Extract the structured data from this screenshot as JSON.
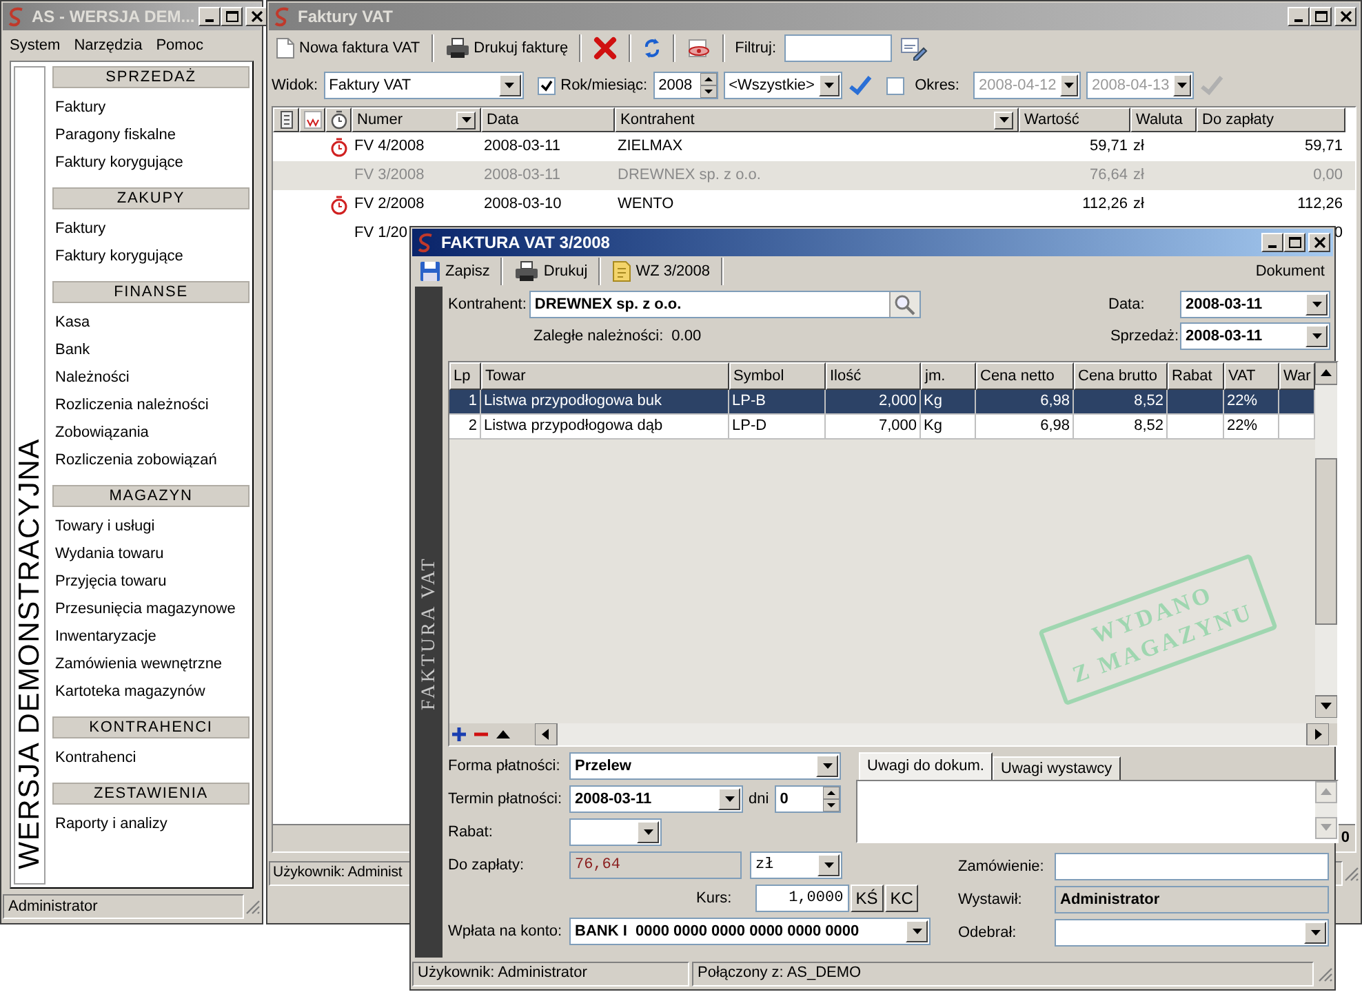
{
  "main_window": {
    "title": "AS - WERSJA DEM...",
    "active": false,
    "menu": [
      "System",
      "Narzędzia",
      "Pomoc"
    ],
    "side_label": "WERSJA DEMONSTRACYJNA",
    "sections": [
      {
        "title": "SPRZEDAŻ",
        "items": [
          "Faktury",
          "Paragony fiskalne",
          "Faktury korygujące"
        ]
      },
      {
        "title": "ZAKUPY",
        "items": [
          "Faktury",
          "Faktury korygujące"
        ]
      },
      {
        "title": "FINANSE",
        "items": [
          "Kasa",
          "Bank",
          "Należności",
          "Rozliczenia należności",
          "Zobowiązania",
          "Rozliczenia zobowiązań"
        ]
      },
      {
        "title": "MAGAZYN",
        "items": [
          "Towary i usługi",
          "Wydania towaru",
          "Przyjęcia towaru",
          "Przesunięcia magazynowe",
          "Inwentaryzacje",
          "Zamówienia wewnętrzne",
          "Kartoteka magazynów"
        ]
      },
      {
        "title": "KONTRAHENCI",
        "items": [
          "Kontrahenci"
        ]
      },
      {
        "title": "ZESTAWIENIA",
        "items": [
          "Raporty i analizy"
        ]
      }
    ],
    "status_bar": "Administrator"
  },
  "list_window": {
    "title": "Faktury VAT",
    "active": false,
    "toolbar": [
      {
        "kind": "new",
        "label": "Nowa faktura VAT"
      },
      {
        "kind": "print",
        "label": "Drukuj fakturę"
      },
      {
        "kind": "delete"
      },
      {
        "kind": "refresh"
      },
      {
        "kind": "preview"
      }
    ],
    "filter_label": "Filtruj:",
    "view": {
      "label": "Widok:",
      "value": "Faktury VAT"
    },
    "year_month": {
      "checked": true,
      "label": "Rok/miesiąc:",
      "year": "2008",
      "month": "<Wszystkie>"
    },
    "period": {
      "checked": false,
      "label": "Okres:",
      "from": "2008-04-12",
      "to": "2008-04-13"
    },
    "table": {
      "columns": [
        "Numer",
        "Data",
        "Kontrahent",
        "Wartość",
        "Waluta",
        "Do zapłaty"
      ],
      "rows": [
        {
          "overdue": true,
          "paid": false,
          "selected": false,
          "numer": "FV 4/2008",
          "data": "2008-03-11",
          "kontrahent": "ZIELMAX",
          "wartosc": "59,71",
          "waluta": "zł",
          "do_zaplaty": "59,71"
        },
        {
          "overdue": false,
          "paid": true,
          "selected": true,
          "numer": "FV 3/2008",
          "data": "2008-03-11",
          "kontrahent": "DREWNEX sp. z o.o.",
          "wartosc": "76,64",
          "waluta": "zł",
          "do_zaplaty": "0,00"
        },
        {
          "overdue": true,
          "paid": false,
          "selected": false,
          "numer": "FV 2/2008",
          "data": "2008-03-10",
          "kontrahent": "WENTO",
          "wartosc": "112,26",
          "waluta": "zł",
          "do_zaplaty": "112,26"
        },
        {
          "overdue": false,
          "paid": false,
          "selected": false,
          "numer": "FV 1/20",
          "do_zaplaty": "0"
        }
      ]
    },
    "footer_value": "0",
    "status_bar": "Użykownik: Administ"
  },
  "invoice_window": {
    "title": "FAKTURA VAT 3/2008",
    "active": true,
    "toolbar": [
      {
        "kind": "save",
        "label": "Zapisz"
      },
      {
        "kind": "print",
        "label": "Drukuj"
      },
      {
        "kind": "document",
        "label": "WZ 3/2008"
      }
    ],
    "menu_label": "Dokument",
    "side_label": "FAKTURA VAT",
    "contractor": {
      "label": "Kontrahent:",
      "value": "DREWNEX sp. z o.o."
    },
    "arrears": {
      "label": "Zaległe należności:",
      "value": "0.00"
    },
    "date": {
      "label": "Data:",
      "value": "2008-03-11"
    },
    "sale_date": {
      "label": "Sprzedaż:",
      "value": "2008-03-11"
    },
    "items": {
      "columns": [
        "Lp",
        "Towar",
        "Symbol",
        "Ilość",
        "jm.",
        "Cena netto",
        "Cena brutto",
        "Rabat",
        "VAT",
        "War"
      ],
      "rows": [
        {
          "selected": true,
          "lp": "1",
          "towar": "Listwa przypodłogowa buk",
          "symbol": "LP-B",
          "ilosc": "2,000",
          "jm": "Kg",
          "netto": "6,98",
          "brutto": "8,52",
          "vat": "22%"
        },
        {
          "selected": false,
          "lp": "2",
          "towar": "Listwa przypodłogowa dąb",
          "symbol": "LP-D",
          "ilosc": "7,000",
          "jm": "Kg",
          "netto": "6,98",
          "brutto": "8,52",
          "vat": "22%"
        }
      ]
    },
    "stamp": [
      "WYDANO",
      "Z MAGAZYNU"
    ],
    "payment_form": {
      "label": "Forma płatności:",
      "value": "Przelew"
    },
    "due": {
      "label": "Termin płatności:",
      "value": "2008-03-11",
      "days_label": "dni",
      "days": "0"
    },
    "discount": {
      "label": "Rabat:"
    },
    "to_pay": {
      "label": "Do zapłaty:",
      "value": "76,64",
      "currency": "zł"
    },
    "rate": {
      "label": "Kurs:",
      "value": "1,0000",
      "buttons": [
        "KŚ",
        "KC"
      ]
    },
    "account": {
      "label": "Wpłata na konto:",
      "value": "BANK I  0000 0000 0000 0000 0000 0000"
    },
    "notes_tabs": [
      {
        "label": "Uwagi do dokum.",
        "selected": true
      },
      {
        "label": "Uwagi wystawcy",
        "selected": false
      }
    ],
    "order": {
      "label": "Zamówienie:"
    },
    "issued_by": {
      "label": "Wystawił:",
      "value": "Administrator"
    },
    "received_by": {
      "label": "Odebrał:"
    },
    "status_bar": [
      "Użykownik: Administrator",
      "Połączony z: AS_DEMO"
    ]
  }
}
